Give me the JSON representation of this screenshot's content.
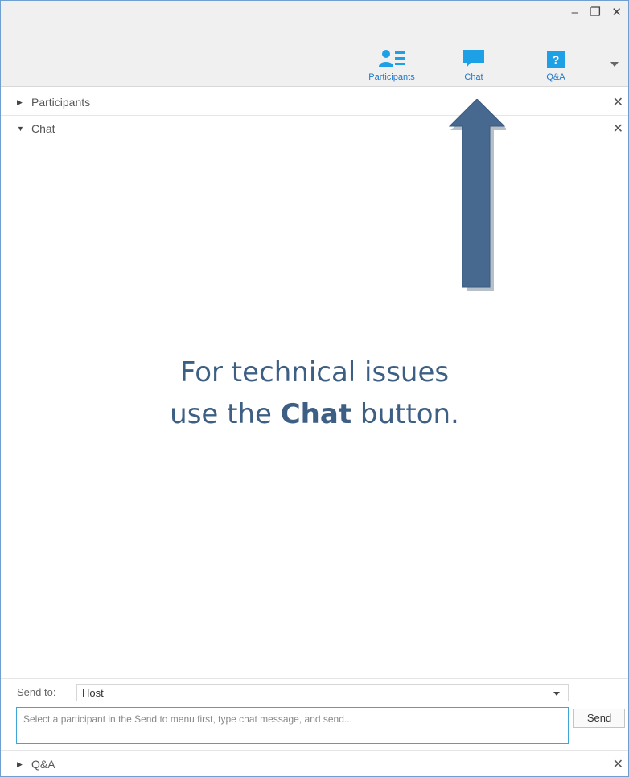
{
  "window_controls": {
    "minimize": "–",
    "restore": "❐",
    "close": "✕"
  },
  "toolbar": {
    "participants_label": "Participants",
    "chat_label": "Chat",
    "qa_label": "Q&A",
    "qa_icon_glyph": "?",
    "accent_color": "#1ea0e6"
  },
  "sections": {
    "participants": {
      "title": "Participants",
      "close": "✕"
    },
    "chat": {
      "title": "Chat",
      "close": "✕"
    },
    "qa": {
      "title": "Q&A",
      "close": "✕"
    }
  },
  "overlay": {
    "line1": "For technical issues",
    "line2_prefix": "use the ",
    "line2_bold": "Chat",
    "line2_suffix": " button.",
    "arrow_color": "#48698f"
  },
  "chat": {
    "send_to_label": "Send to:",
    "send_to_value": "Host",
    "input_placeholder": "Select a participant in the Send to menu first, type chat message, and send...",
    "send_button": "Send"
  }
}
